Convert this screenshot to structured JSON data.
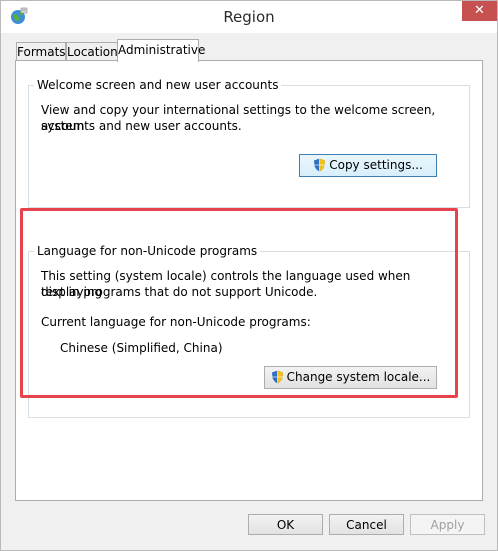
{
  "window": {
    "title": "Region",
    "close_glyph": "✕"
  },
  "tabs": [
    {
      "label": "Formats",
      "active": false
    },
    {
      "label": "Location",
      "active": false
    },
    {
      "label": "Administrative",
      "active": true
    }
  ],
  "welcome_group": {
    "legend": "Welcome screen and new user accounts",
    "description_line1": "View and copy your international settings to the welcome screen, system",
    "description_line2": "accounts and new user accounts.",
    "copy_button": "Copy settings..."
  },
  "nonunicode_group": {
    "legend": "Language for non-Unicode programs",
    "description_line1": "This setting (system locale) controls the language used when displaying",
    "description_line2": "text in programs that do not support Unicode.",
    "current_label": "Current language for non-Unicode programs:",
    "current_value": "Chinese (Simplified, China)",
    "change_button": "Change system locale..."
  },
  "footer": {
    "ok": "OK",
    "cancel": "Cancel",
    "apply": "Apply"
  },
  "colors": {
    "highlight": "#e8434d",
    "close": "#c75050"
  },
  "icons": [
    "globe-icon",
    "shield-icon",
    "close-icon"
  ]
}
